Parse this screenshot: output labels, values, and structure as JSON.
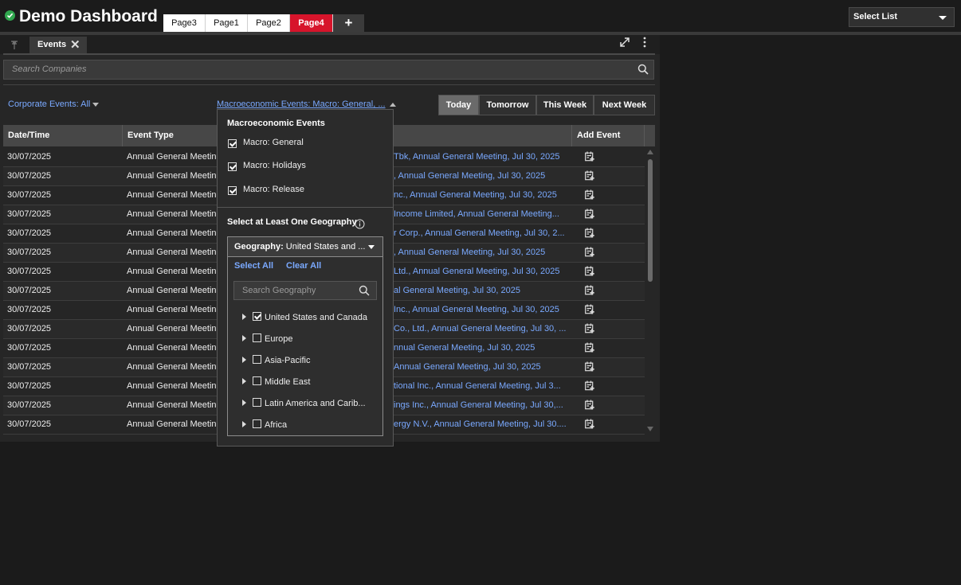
{
  "app": {
    "title": "Demo Dashboard"
  },
  "page_tabs": [
    {
      "label": "Page3"
    },
    {
      "label": "Page1"
    },
    {
      "label": "Page2"
    },
    {
      "label": "Page4"
    }
  ],
  "select_list": {
    "label": "Select List"
  },
  "panel": {
    "tab_label": "Events"
  },
  "search": {
    "placeholder": "Search Companies"
  },
  "filters": {
    "corporate": "Corporate Events: All",
    "macro": "Macroeconomic Events: Macro: General, ..."
  },
  "date_buttons": [
    {
      "label": "Today"
    },
    {
      "label": "Tomorrow"
    },
    {
      "label": "This Week"
    },
    {
      "label": "Next Week"
    }
  ],
  "table": {
    "headers": {
      "date": "Date/Time",
      "type": "Event Type",
      "add": "Add Event"
    },
    "rows": [
      {
        "date": "30/07/2025",
        "type": "Annual General Meeting",
        "event": "Tbk, Annual General Meeting, Jul 30, 2025"
      },
      {
        "date": "30/07/2025",
        "type": "Annual General Meeting",
        "event": ", Annual General Meeting, Jul 30, 2025"
      },
      {
        "date": "30/07/2025",
        "type": "Annual General Meeting",
        "event": "nc., Annual General Meeting, Jul 30, 2025"
      },
      {
        "date": "30/07/2025",
        "type": "Annual General Meeting",
        "event": "Income Limited, Annual General Meeting..."
      },
      {
        "date": "30/07/2025",
        "type": "Annual General Meeting",
        "event": "r Corp., Annual General Meeting, Jul 30, 2..."
      },
      {
        "date": "30/07/2025",
        "type": "Annual General Meeting",
        "event": ", Annual General Meeting, Jul 30, 2025"
      },
      {
        "date": "30/07/2025",
        "type": "Annual General Meeting",
        "event": "Ltd., Annual General Meeting, Jul 30, 2025"
      },
      {
        "date": "30/07/2025",
        "type": "Annual General Meeting",
        "event": "al General Meeting, Jul 30, 2025"
      },
      {
        "date": "30/07/2025",
        "type": "Annual General Meeting",
        "event": "Inc., Annual General Meeting, Jul 30, 2025"
      },
      {
        "date": "30/07/2025",
        "type": "Annual General Meeting",
        "event": "Co., Ltd., Annual General Meeting, Jul 30, ..."
      },
      {
        "date": "30/07/2025",
        "type": "Annual General Meeting",
        "event": "nnual General Meeting, Jul 30, 2025"
      },
      {
        "date": "30/07/2025",
        "type": "Annual General Meeting",
        "event": "Annual General Meeting, Jul 30, 2025"
      },
      {
        "date": "30/07/2025",
        "type": "Annual General Meeting",
        "event": "tional Inc., Annual General Meeting, Jul 3..."
      },
      {
        "date": "30/07/2025",
        "type": "Annual General Meeting",
        "event": "ings Inc., Annual General Meeting, Jul 30,..."
      },
      {
        "date": "30/07/2025",
        "type": "Annual General Meeting",
        "event": "ergy N.V., Annual General Meeting, Jul 30...."
      }
    ]
  },
  "macro_popup": {
    "title": "Macroeconomic Events",
    "options": [
      {
        "label": "Macro: General",
        "checked": true
      },
      {
        "label": "Macro: Holidays",
        "checked": true
      },
      {
        "label": "Macro: Release",
        "checked": true
      }
    ],
    "geo_heading": "Select at Least One Geography",
    "geo_button_prefix": "Geography:",
    "geo_button_value": "United States and ...",
    "select_all": "Select All",
    "clear_all": "Clear All",
    "geo_search_placeholder": "Search Geography",
    "geographies": [
      {
        "label": "United States and Canada",
        "checked": true
      },
      {
        "label": "Europe",
        "checked": false
      },
      {
        "label": "Asia-Pacific",
        "checked": false
      },
      {
        "label": "Middle East",
        "checked": false
      },
      {
        "label": "Latin America and Carib...",
        "checked": false
      },
      {
        "label": "Africa",
        "checked": false
      }
    ]
  },
  "colors": {
    "accent": "#d7142b",
    "link": "#7aa9ff",
    "status_ok": "#31a84f"
  }
}
